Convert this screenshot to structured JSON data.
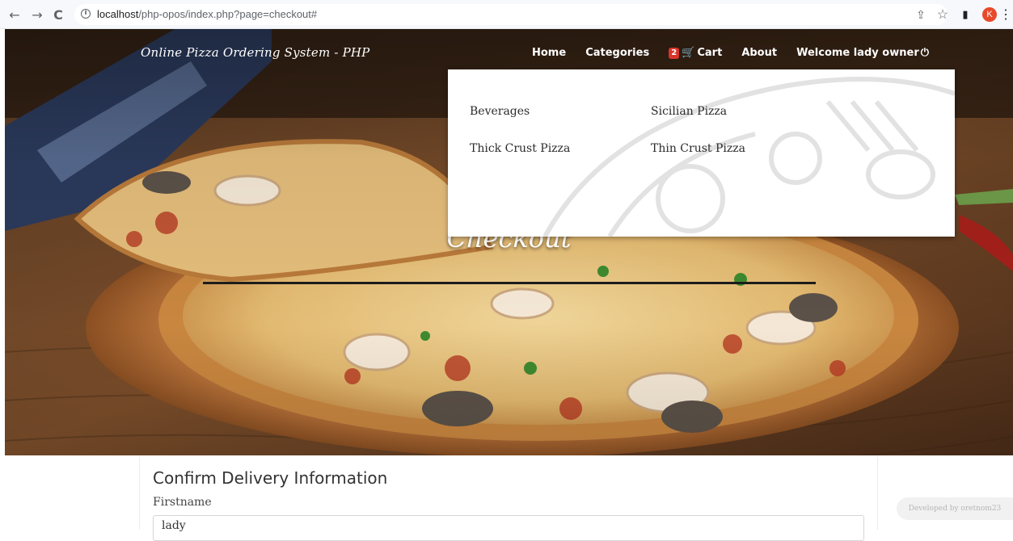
{
  "browser": {
    "url_host": "localhost",
    "url_path": "/php-opos/index.php?page=checkout#",
    "profile_initial": "K",
    "back_icon": "←",
    "forward_icon": "→",
    "reload_icon": "C",
    "info_icon": "i",
    "share_icon": "⇪",
    "star_icon": "☆",
    "sidepanel_icon": "▮",
    "menu_icon": "⋮"
  },
  "site": {
    "brand": "Online Pizza Ordering System - PHP",
    "nav": {
      "home": "Home",
      "categories": "Categories",
      "cart_count": "2",
      "cart_icon": "🛒",
      "cart": "Cart",
      "about": "About",
      "welcome": "Welcome lady owner",
      "power_icon": "⏻"
    }
  },
  "categories_dropdown": {
    "items": [
      "Beverages",
      "Sicilian Pizza",
      "Thick Crust Pizza",
      "Thin Crust Pizza"
    ]
  },
  "hero": {
    "heading": "Checkout"
  },
  "form": {
    "title": "Confirm Delivery Information",
    "firstname_label": "Firstname",
    "firstname_value": "lady"
  },
  "footer": {
    "developer": "Developed by oretnom23"
  }
}
